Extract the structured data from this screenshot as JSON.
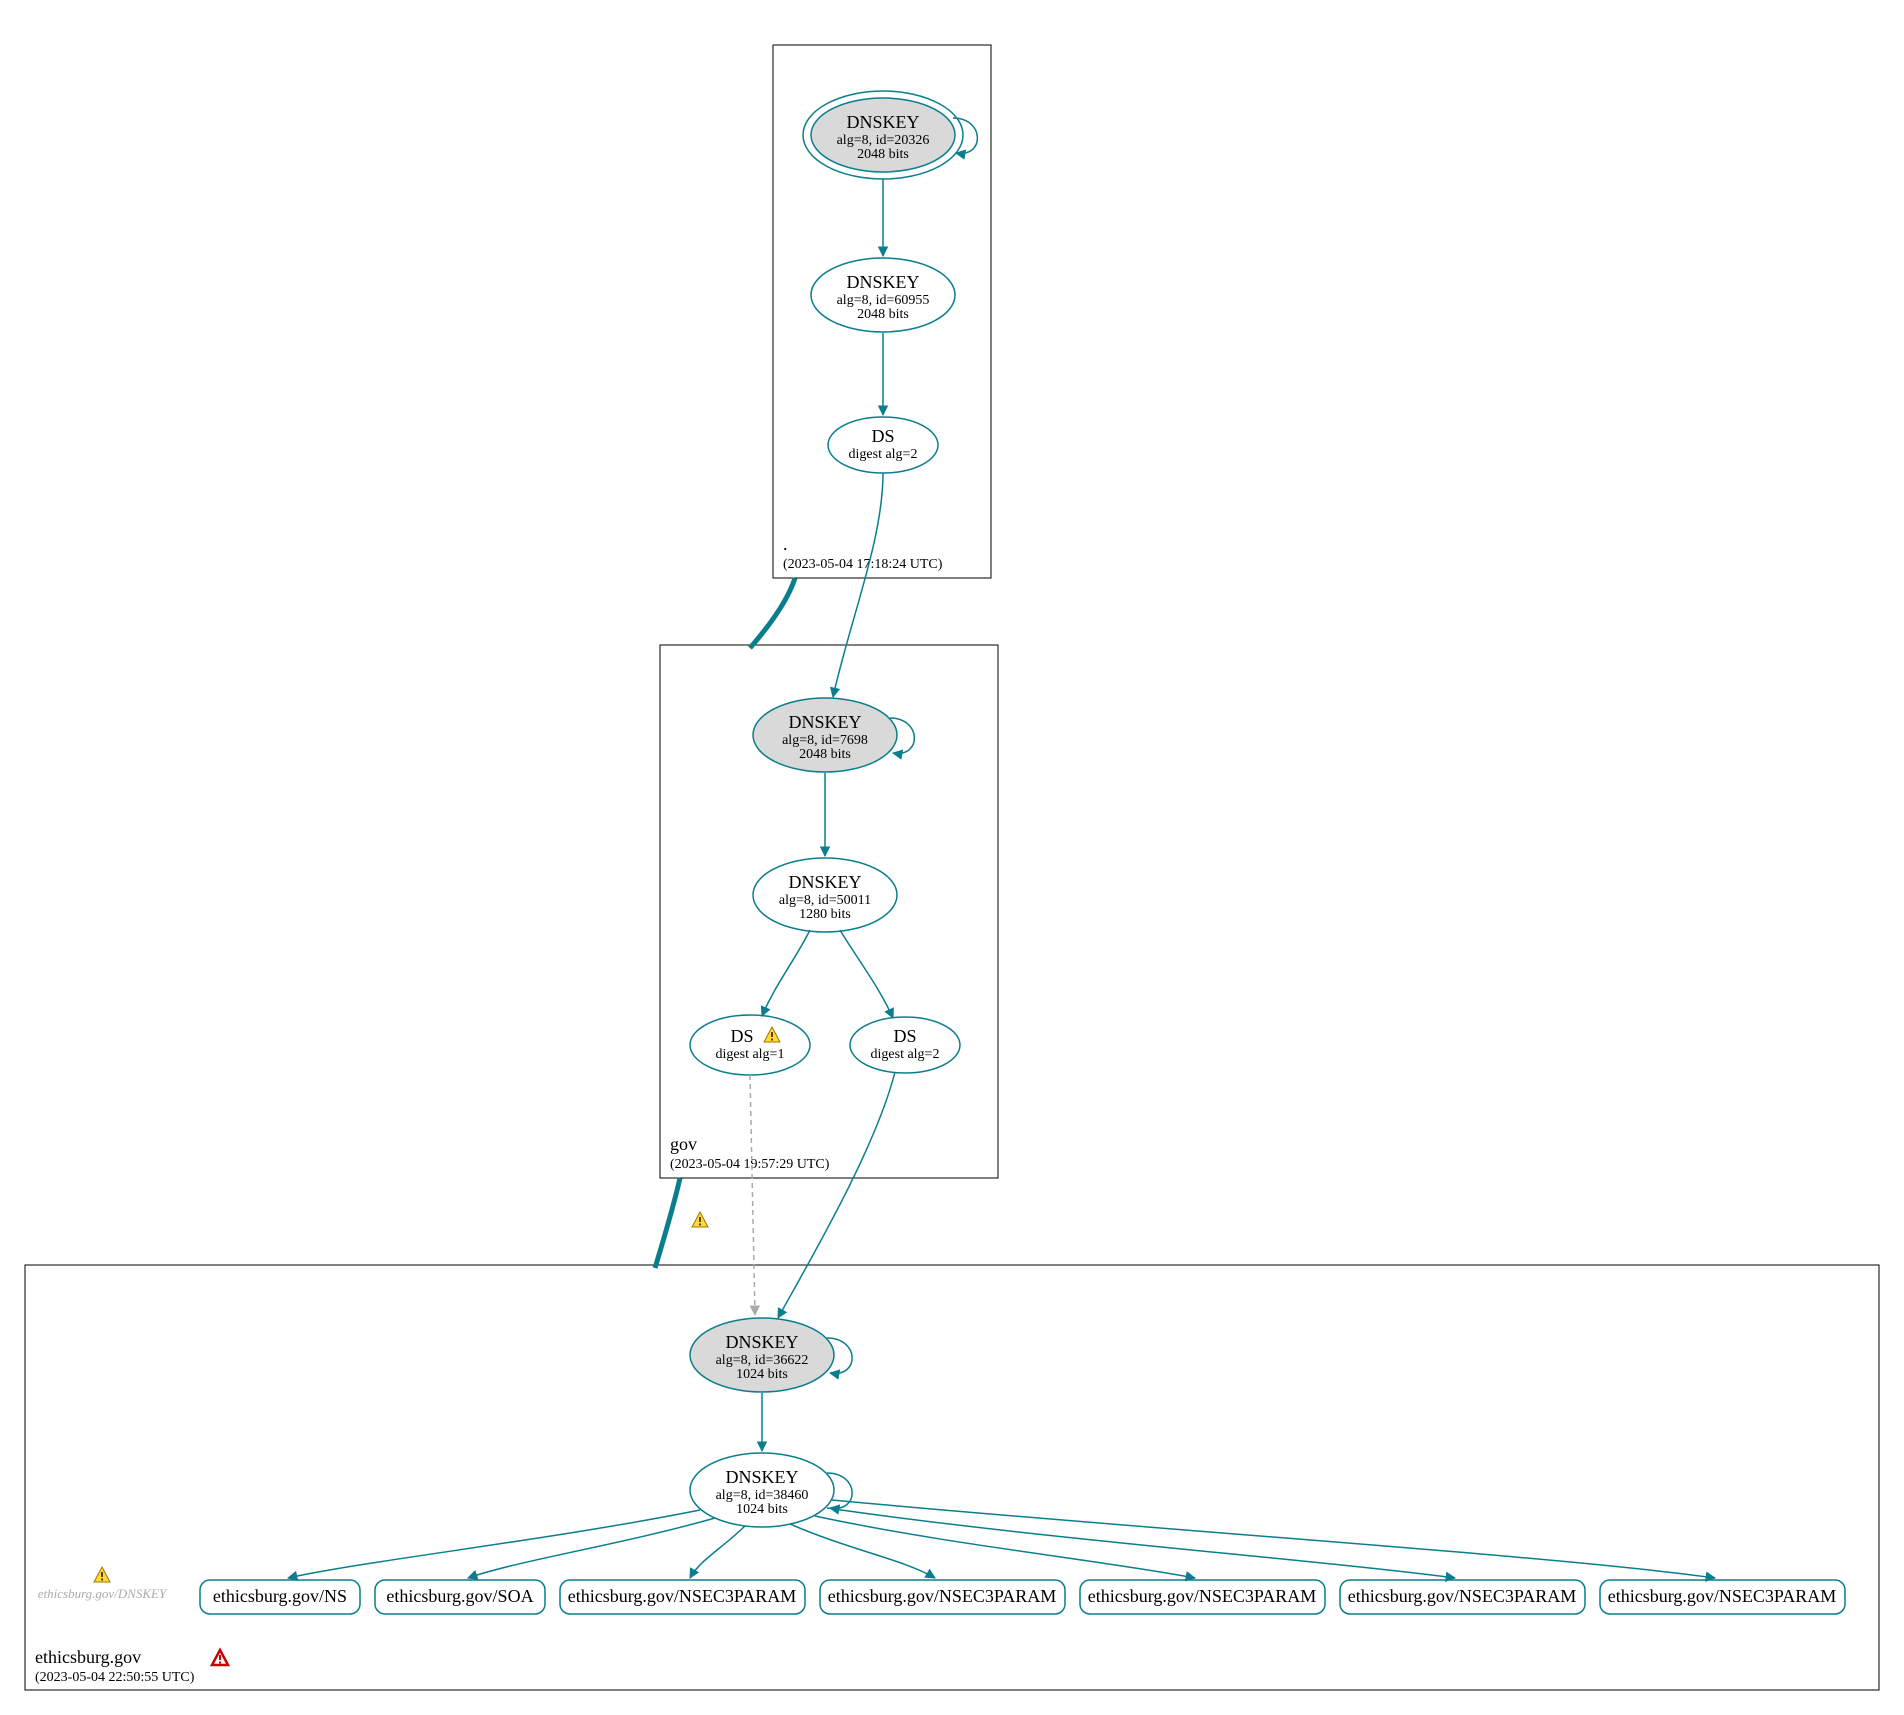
{
  "zones": {
    "root": {
      "name": ".",
      "timestamp": "(2023-05-04 17:18:24 UTC)"
    },
    "gov": {
      "name": "gov",
      "timestamp": "(2023-05-04 19:57:29 UTC)"
    },
    "ethicsburg": {
      "name": "ethicsburg.gov",
      "timestamp": "(2023-05-04 22:50:55 UTC)"
    }
  },
  "nodes": {
    "root_ksk": {
      "title": "DNSKEY",
      "line2": "alg=8, id=20326",
      "line3": "2048 bits"
    },
    "root_zsk": {
      "title": "DNSKEY",
      "line2": "alg=8, id=60955",
      "line3": "2048 bits"
    },
    "root_ds": {
      "title": "DS",
      "line2": "digest alg=2"
    },
    "gov_ksk": {
      "title": "DNSKEY",
      "line2": "alg=8, id=7698",
      "line3": "2048 bits"
    },
    "gov_zsk": {
      "title": "DNSKEY",
      "line2": "alg=8, id=50011",
      "line3": "1280 bits"
    },
    "gov_ds1": {
      "title": "DS",
      "line2": "digest alg=1"
    },
    "gov_ds2": {
      "title": "DS",
      "line2": "digest alg=2"
    },
    "eth_ksk": {
      "title": "DNSKEY",
      "line2": "alg=8, id=36622",
      "line3": "1024 bits"
    },
    "eth_zsk": {
      "title": "DNSKEY",
      "line2": "alg=8, id=38460",
      "line3": "1024 bits"
    },
    "missing_dnskey": "ethicsburg.gov/DNSKEY"
  },
  "rrsets": [
    "ethicsburg.gov/NS",
    "ethicsburg.gov/SOA",
    "ethicsburg.gov/NSEC3PARAM",
    "ethicsburg.gov/NSEC3PARAM",
    "ethicsburg.gov/NSEC3PARAM",
    "ethicsburg.gov/NSEC3PARAM",
    "ethicsburg.gov/NSEC3PARAM"
  ]
}
